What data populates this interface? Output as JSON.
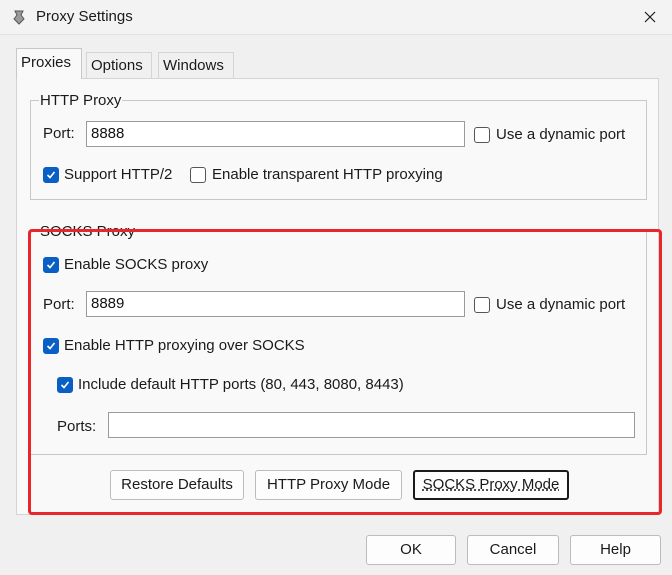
{
  "window": {
    "title": "Proxy Settings",
    "icons": {
      "app": "proxy-app-icon",
      "close": "close-icon"
    }
  },
  "tabs": [
    {
      "label": "Proxies",
      "active": true
    },
    {
      "label": "Options",
      "active": false
    },
    {
      "label": "Windows",
      "active": false
    }
  ],
  "http_proxy": {
    "group_title": "HTTP Proxy",
    "port_label": "Port:",
    "port_value": "8888",
    "dynamic_port_label": "Use a dynamic port",
    "dynamic_port_checked": false,
    "support_http2_label": "Support HTTP/2",
    "support_http2_checked": true,
    "transparent_label": "Enable transparent HTTP proxying",
    "transparent_checked": false
  },
  "socks_proxy": {
    "group_title": "SOCKS Proxy",
    "enable_label": "Enable SOCKS proxy",
    "enable_checked": true,
    "port_label": "Port:",
    "port_value": "8889",
    "dynamic_port_label": "Use a dynamic port",
    "dynamic_port_checked": false,
    "http_over_socks_label": "Enable HTTP proxying over SOCKS",
    "http_over_socks_checked": true,
    "include_default_ports_label": "Include default HTTP ports (80, 443, 8080, 8443)",
    "include_default_ports_checked": true,
    "ports_label": "Ports:",
    "ports_value": ""
  },
  "mode_buttons": {
    "restore_defaults": "Restore Defaults",
    "http_proxy_mode": "HTTP Proxy Mode",
    "socks_proxy_mode": "SOCKS Proxy Mode"
  },
  "dialog_buttons": {
    "ok": "OK",
    "cancel": "Cancel",
    "help": "Help"
  },
  "colors": {
    "checkbox_checked": "#0a5fc4",
    "highlight_border": "#e8262b"
  }
}
